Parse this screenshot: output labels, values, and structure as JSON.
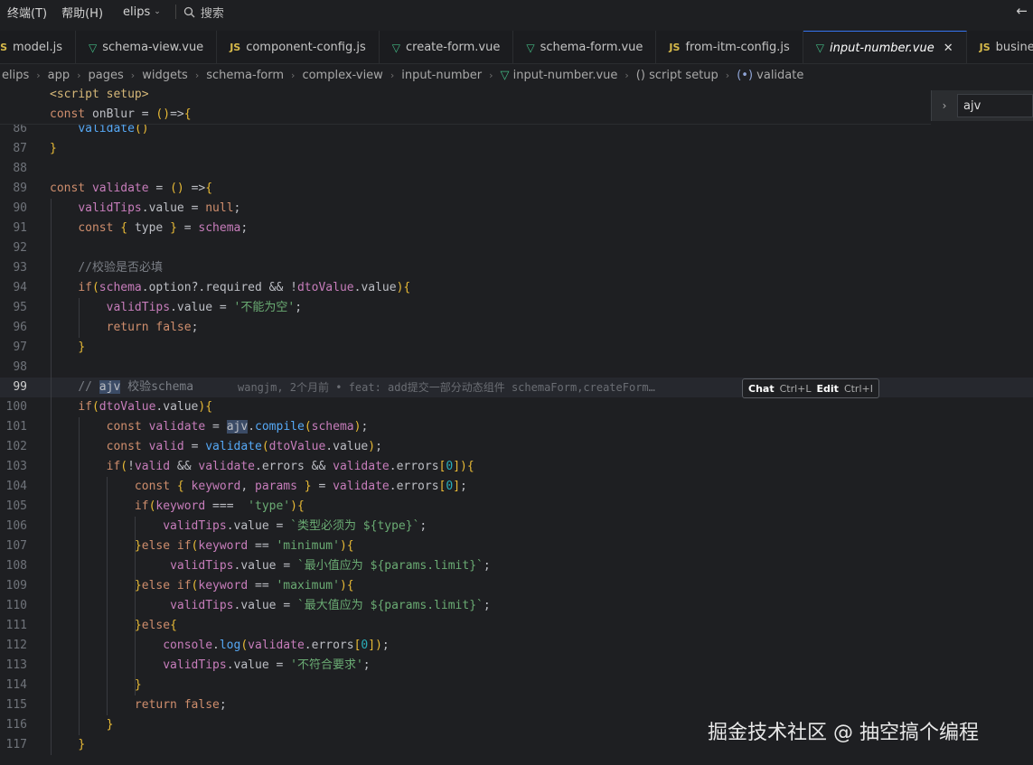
{
  "menu": {
    "terminal": "终端(T)",
    "help": "帮助(H)",
    "project": "elips",
    "search": "搜索"
  },
  "tabs": [
    {
      "type": "JS",
      "label": "model.js"
    },
    {
      "type": "VUE",
      "label": "schema-view.vue"
    },
    {
      "type": "JS",
      "label": "component-config.js"
    },
    {
      "type": "VUE",
      "label": "create-form.vue"
    },
    {
      "type": "VUE",
      "label": "schema-form.vue"
    },
    {
      "type": "JS",
      "label": "from-itm-config.js"
    },
    {
      "type": "VUE",
      "label": "input-number.vue",
      "active": true
    },
    {
      "type": "JS",
      "label": "business.js"
    }
  ],
  "breadcrumb": [
    "elips",
    "app",
    "pages",
    "widgets",
    "schema-form",
    "complex-view",
    "input-number",
    "input-number.vue",
    "script setup",
    "validate"
  ],
  "find": {
    "value": "ajv"
  },
  "inlay": {
    "chat": "Chat",
    "chat_key": "Ctrl+L",
    "edit": "Edit",
    "edit_key": "Ctrl+I"
  },
  "sticky": [
    "<script setup>",
    "const onBlur = ()=>{"
  ],
  "blame": "wangjm, 2个月前 • feat: add提交一部分动态组件 schemaForm,createForm…",
  "lines": [
    {
      "n": "86",
      "text": "    validate()"
    },
    {
      "n": "87",
      "text": "}"
    },
    {
      "n": "88",
      "text": ""
    },
    {
      "n": "89",
      "text": "const validate = () =>{"
    },
    {
      "n": "90",
      "text": "    validTips.value = null;"
    },
    {
      "n": "91",
      "text": "    const { type } = schema;"
    },
    {
      "n": "92",
      "text": ""
    },
    {
      "n": "93",
      "text": "    //校验是否必填"
    },
    {
      "n": "94",
      "text": "    if(schema.option?.required && !dtoValue.value){"
    },
    {
      "n": "95",
      "text": "        validTips.value = '不能为空';"
    },
    {
      "n": "96",
      "text": "        return false;"
    },
    {
      "n": "97",
      "text": "    }"
    },
    {
      "n": "98",
      "text": ""
    },
    {
      "n": "99",
      "text": "    // ajv 校验schema"
    },
    {
      "n": "100",
      "text": "    if(dtoValue.value){"
    },
    {
      "n": "101",
      "text": "        const validate = ajv.compile(schema);"
    },
    {
      "n": "102",
      "text": "        const valid = validate(dtoValue.value);"
    },
    {
      "n": "103",
      "text": "        if(!valid && validate.errors && validate.errors[0]){"
    },
    {
      "n": "104",
      "text": "            const { keyword, params } = validate.errors[0];"
    },
    {
      "n": "105",
      "text": "            if(keyword ===  'type'){"
    },
    {
      "n": "106",
      "text": "                validTips.value = `类型必须为 ${type}`;"
    },
    {
      "n": "107",
      "text": "            }else if(keyword == 'minimum'){"
    },
    {
      "n": "108",
      "text": "                 validTips.value = `最小值应为 ${params.limit}`;"
    },
    {
      "n": "109",
      "text": "            }else if(keyword == 'maximum'){"
    },
    {
      "n": "110",
      "text": "                 validTips.value = `最大值应为 ${params.limit}`;"
    },
    {
      "n": "111",
      "text": "            }else{"
    },
    {
      "n": "112",
      "text": "                console.log(validate.errors[0]);"
    },
    {
      "n": "113",
      "text": "                validTips.value = '不符合要求';"
    },
    {
      "n": "114",
      "text": "            }"
    },
    {
      "n": "115",
      "text": "            return false;"
    },
    {
      "n": "116",
      "text": "        }"
    },
    {
      "n": "117",
      "text": "    }"
    }
  ],
  "current_line": "99",
  "watermark": "掘金技术社区 @ 抽空搞个编程"
}
